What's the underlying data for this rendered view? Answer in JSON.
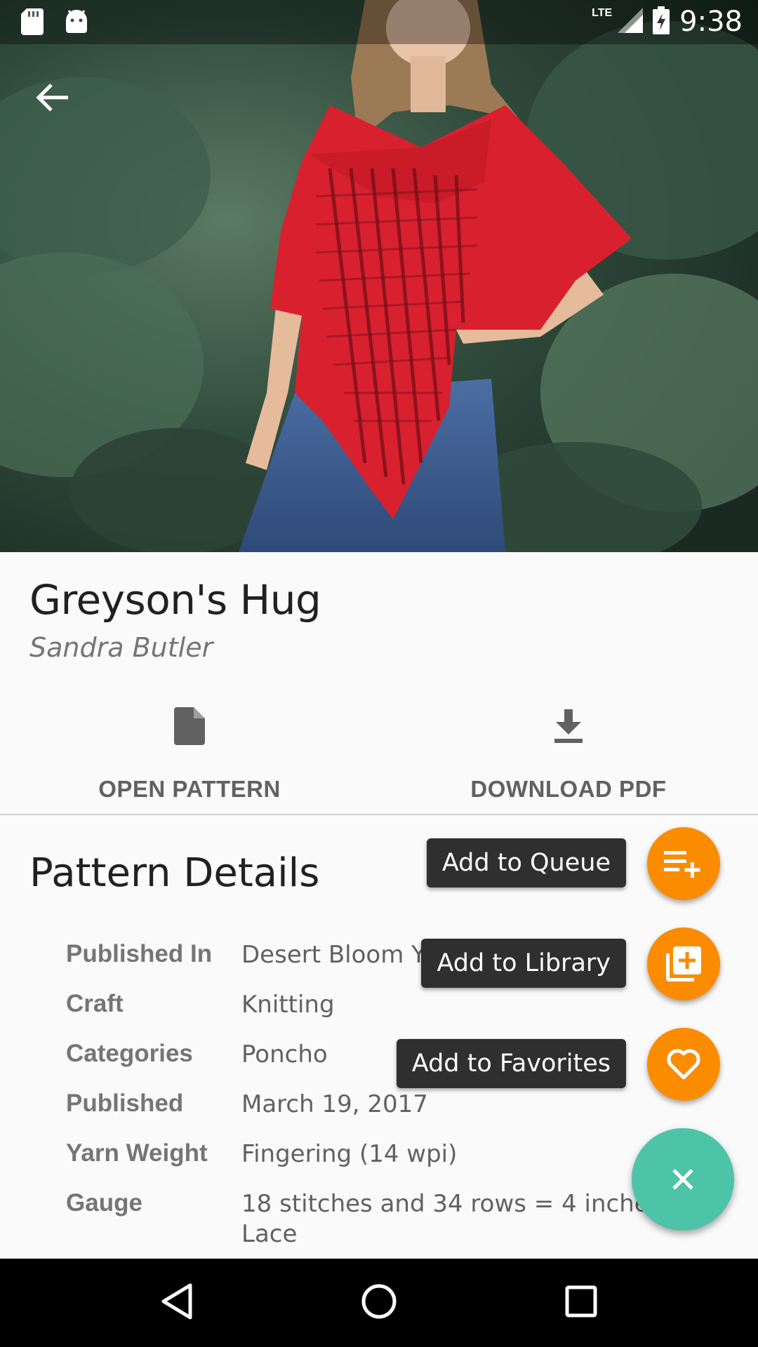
{
  "status_bar": {
    "time": "9:38",
    "network": "LTE",
    "left_icons": [
      "sd-card-icon",
      "android-icon"
    ],
    "right_icons": [
      "signal-icon",
      "battery-charging-icon"
    ]
  },
  "hero": {
    "image_alt": "Woman wearing red lace knit poncho in front of evergreen shrubs",
    "back_icon": "arrow-back-icon"
  },
  "pattern": {
    "title": "Greyson's Hug",
    "designer": "Sandra Butler"
  },
  "actions": {
    "open_pattern": "OPEN PATTERN",
    "download_pdf": "DOWNLOAD PDF"
  },
  "details": {
    "title": "Pattern Details",
    "rows": [
      {
        "label": "Published In",
        "value": "Desert Bloom Yarns"
      },
      {
        "label": "Craft",
        "value": "Knitting"
      },
      {
        "label": "Categories",
        "value": "Poncho"
      },
      {
        "label": "Published",
        "value": "March 19, 2017"
      },
      {
        "label": "Yarn Weight",
        "value": "Fingering (14 wpi)"
      },
      {
        "label": "Gauge",
        "value": "18 stitches and 34 rows = 4 inches in Lace"
      }
    ]
  },
  "fab_menu": {
    "queue": "Add to Queue",
    "library": "Add to Library",
    "favorites": "Add to Favorites",
    "accent_color": "#fb8c00",
    "main_color": "#4dc3a8"
  },
  "nav": {
    "icons": [
      "back-triangle-icon",
      "home-circle-icon",
      "recents-square-icon"
    ]
  }
}
